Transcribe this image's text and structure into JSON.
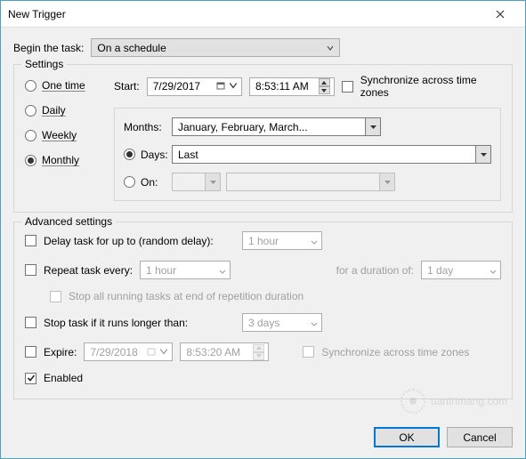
{
  "window": {
    "title": "New Trigger"
  },
  "begin": {
    "label": "Begin the task:",
    "value": "On a schedule"
  },
  "settings": {
    "legend": "Settings",
    "radios": {
      "onetime": "One time",
      "daily": "Daily",
      "weekly": "Weekly",
      "monthly": "Monthly"
    },
    "start": {
      "label": "Start:",
      "date": "7/29/2017",
      "time": "8:53:11 AM",
      "sync": "Synchronize across time zones"
    },
    "months": {
      "label": "Months:",
      "value": "January, February, March..."
    },
    "days": {
      "label": "Days:",
      "value": "Last"
    },
    "on": {
      "label": "On:"
    }
  },
  "advanced": {
    "legend": "Advanced settings",
    "delay": {
      "label": "Delay task for up to (random delay):",
      "value": "1 hour"
    },
    "repeat": {
      "label": "Repeat task every:",
      "value": "1 hour",
      "duration_label": "for a duration of:",
      "duration_value": "1 day"
    },
    "stop_repeat": "Stop all running tasks at end of repetition duration",
    "stop_long": {
      "label": "Stop task if it runs longer than:",
      "value": "3 days"
    },
    "expire": {
      "label": "Expire:",
      "date": "7/29/2018",
      "time": "8:53:20 AM",
      "sync": "Synchronize across time zones"
    },
    "enabled": "Enabled"
  },
  "buttons": {
    "ok": "OK",
    "cancel": "Cancel"
  },
  "watermark": "uantrimang.com"
}
